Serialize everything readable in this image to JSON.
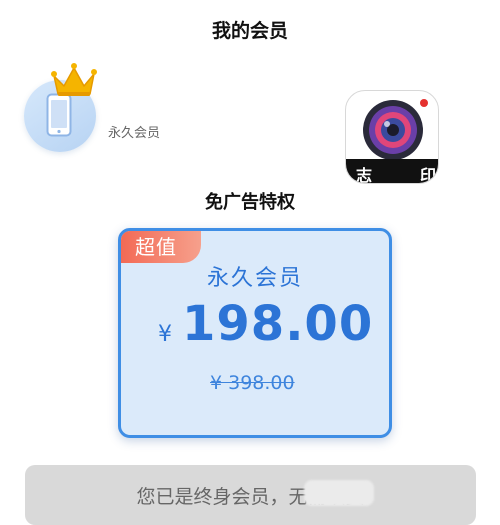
{
  "header": {
    "title": "我的会员"
  },
  "member": {
    "status": "永久会员"
  },
  "app": {
    "label_left": "志",
    "label_right": "印"
  },
  "section": {
    "title": "免广告特权"
  },
  "plan": {
    "badge": "超值",
    "name": "永久会员",
    "currency": "¥",
    "price": "198.00",
    "original_price": "¥ 398.00"
  },
  "footer": {
    "message": "您已是终身会员，无需续费"
  },
  "colors": {
    "accent": "#2c74d6",
    "card_border": "#3f8ee5",
    "card_bg": "#dbeafa",
    "badge": "#f36a55"
  }
}
